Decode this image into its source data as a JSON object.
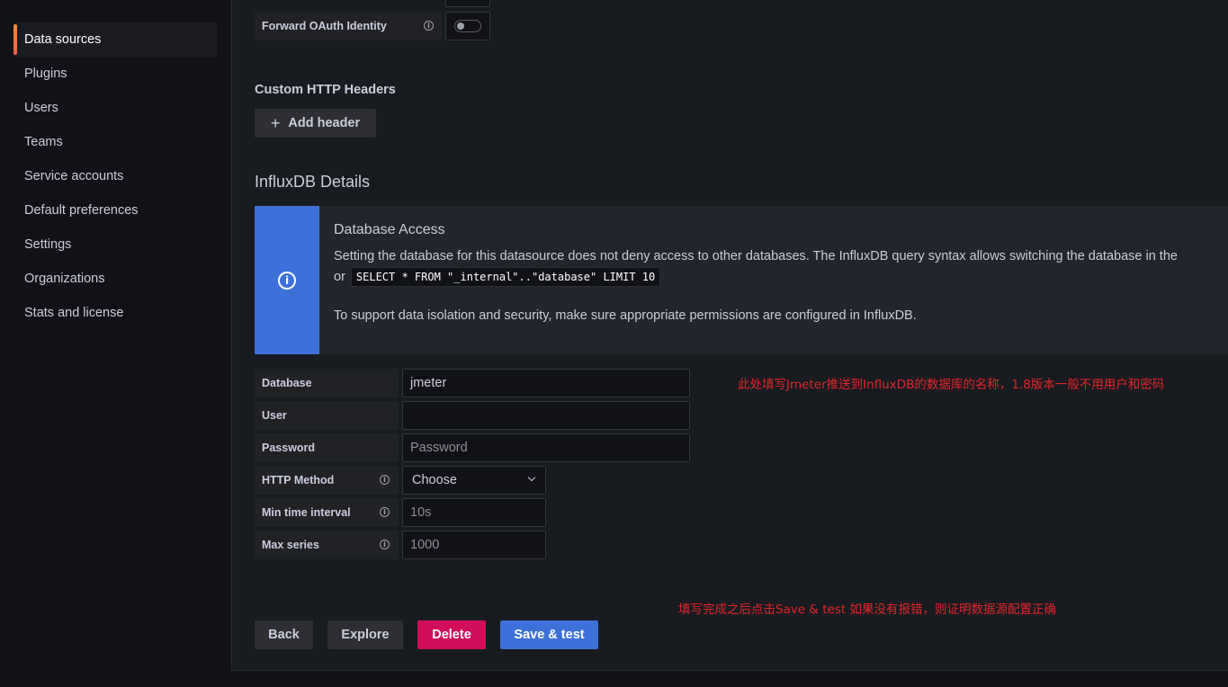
{
  "sidebar": {
    "items": [
      {
        "label": "Data sources",
        "active": true
      },
      {
        "label": "Plugins"
      },
      {
        "label": "Users"
      },
      {
        "label": "Teams"
      },
      {
        "label": "Service accounts"
      },
      {
        "label": "Default preferences"
      },
      {
        "label": "Settings"
      },
      {
        "label": "Organizations"
      },
      {
        "label": "Stats and license"
      }
    ]
  },
  "auth": {
    "forward_oauth_label": "Forward OAuth Identity",
    "forward_oauth_enabled": false
  },
  "custom_headers": {
    "title": "Custom HTTP Headers",
    "add_button": "Add header"
  },
  "influx": {
    "section_title": "InfluxDB Details",
    "alert": {
      "title": "Database Access",
      "line1": "Setting the database for this datasource does not deny access to other databases. The InfluxDB query syntax allows switching the database in the",
      "line2_prefix": "or",
      "code": "SELECT * FROM \"_internal\"..\"database\" LIMIT 10",
      "line3": "To support data isolation and security, make sure appropriate permissions are configured in InfluxDB."
    },
    "fields": {
      "database": {
        "label": "Database",
        "value": "jmeter"
      },
      "user": {
        "label": "User",
        "value": ""
      },
      "password": {
        "label": "Password",
        "placeholder": "Password"
      },
      "http_method": {
        "label": "HTTP Method",
        "value": "Choose"
      },
      "min_time_interval": {
        "label": "Min time interval",
        "placeholder": "10s"
      },
      "max_series": {
        "label": "Max series",
        "placeholder": "1000"
      }
    }
  },
  "annotations": {
    "database_note": "此处填写Jmeter推送到InfluxDB的数据库的名称，1.8版本一般不用用户和密码",
    "save_note": "填写完成之后点击Save & test 如果没有报错，则证明数据源配置正确"
  },
  "buttons": {
    "back": "Back",
    "explore": "Explore",
    "delete": "Delete",
    "save_test": "Save & test"
  },
  "colors": {
    "accent_blue": "#3d71d9",
    "delete_red": "#d10e5c",
    "annotation_red": "#e0262b"
  }
}
